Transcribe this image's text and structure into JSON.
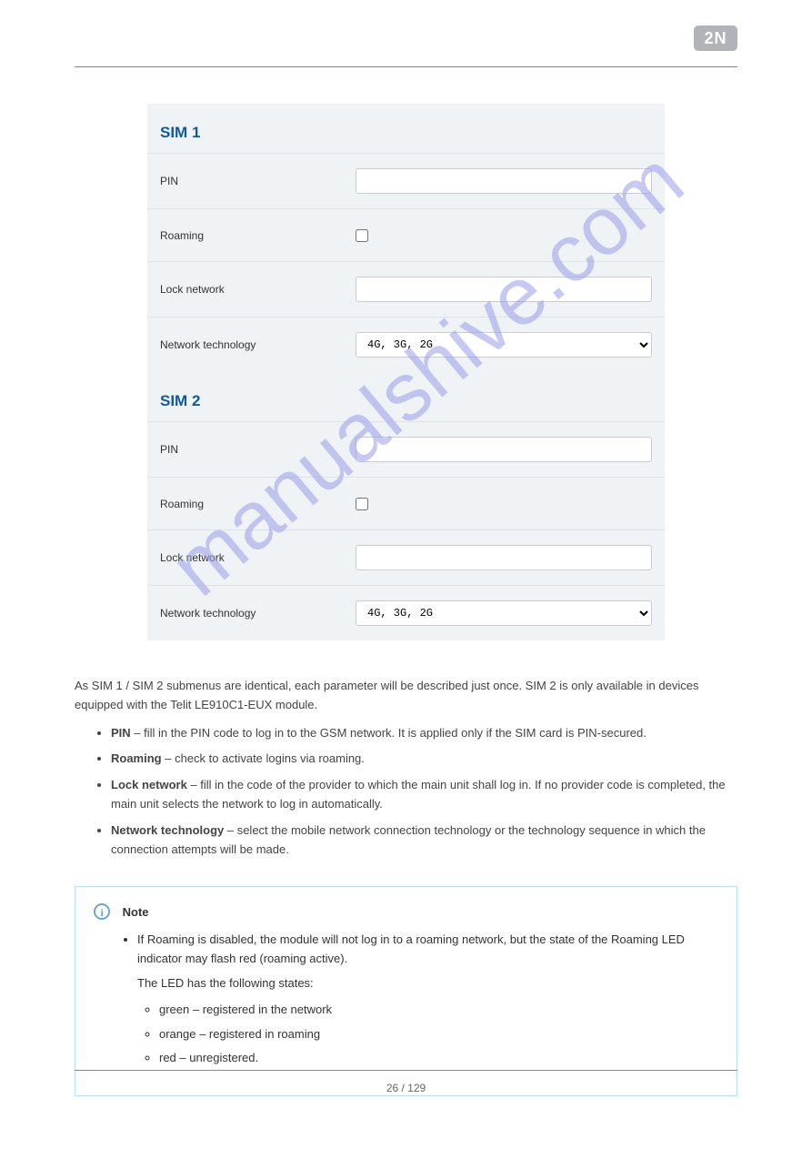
{
  "logo_text": "2N",
  "watermark": "manualshive.com",
  "form": {
    "sim1": {
      "title": "SIM 1",
      "pin_label": "PIN",
      "pin_value": "",
      "roaming_label": "Roaming",
      "lock_label": "Lock network",
      "lock_value": "",
      "tech_label": "Network technology",
      "tech_value": "4G, 3G, 2G"
    },
    "sim2": {
      "title": "SIM 2",
      "pin_label": "PIN",
      "pin_value": "",
      "roaming_label": "Roaming",
      "lock_label": "Lock network",
      "lock_value": "",
      "tech_label": "Network technology",
      "tech_value": "4G, 3G, 2G"
    }
  },
  "intro": "As SIM 1 / SIM 2 submenus are identical, each parameter will be described just once. SIM 2 is only available in devices equipped with the Telit LE910C1-EUX module.",
  "bullets": [
    {
      "label": "PIN",
      "text": " – fill in the PIN code to log in to the GSM network. It is applied only if the SIM card is PIN-secured."
    },
    {
      "label": "Roaming",
      "text": " – check to activate logins via roaming."
    },
    {
      "label": "Lock network",
      "text": " – fill in the code of the provider to which the main unit shall log in. If no provider code is completed, the main unit selects the network to log in automatically."
    },
    {
      "label": "Network technology",
      "text": " – select the mobile network connection technology or the technology sequence in which the connection attempts will be made."
    }
  ],
  "note": {
    "title": "Note",
    "lead": "If Roaming is disabled, the module will not log in to a roaming network, but the state of the Roaming LED indicator may flash red (roaming active).",
    "sub_lead": "The LED has the following states:",
    "items": [
      "green – registered in the network",
      "orange – registered in roaming",
      "red – unregistered."
    ]
  },
  "footer": "26 / 129"
}
